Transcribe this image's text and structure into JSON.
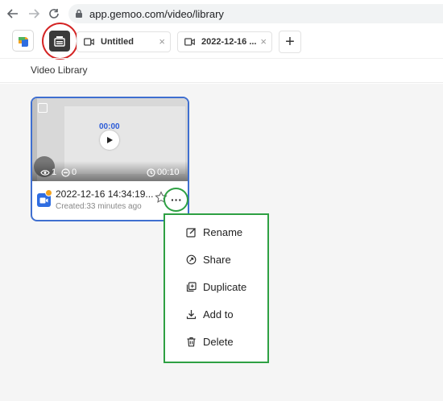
{
  "browser": {
    "url": "app.gemoo.com/video/library"
  },
  "tabs": [
    {
      "label": "Untitled"
    },
    {
      "label": "2022-12-16 ..."
    }
  ],
  "tab_close_glyph": "×",
  "add_tab_glyph": "+",
  "breadcrumb": "Video Library",
  "video": {
    "timer": "00:00",
    "views": "1",
    "comments": "0",
    "duration": "00:10",
    "title": "2022-12-16 14:34:19...",
    "created": "Created:33 minutes ago"
  },
  "more_label": "···",
  "menu": {
    "items": [
      {
        "label": "Rename",
        "icon": "edit-icon"
      },
      {
        "label": "Share",
        "icon": "share-icon"
      },
      {
        "label": "Duplicate",
        "icon": "duplicate-icon"
      },
      {
        "label": "Add to",
        "icon": "add-to-icon"
      },
      {
        "label": "Delete",
        "icon": "trash-icon"
      }
    ]
  },
  "colors": {
    "accent_blue": "#3f6fd0",
    "highlight_red": "#d42424",
    "highlight_green": "#2ea043",
    "badge_orange": "#f3a31d"
  }
}
